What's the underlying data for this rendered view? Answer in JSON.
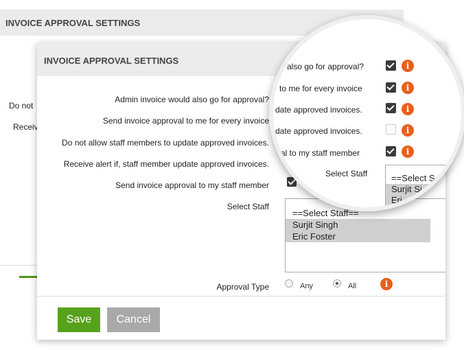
{
  "background": {
    "title": "INVOICE APPROVAL SETTINGS",
    "labels": [
      "Do not",
      "Receiv"
    ]
  },
  "dialog": {
    "title": "INVOICE APPROVAL SETTINGS",
    "rows": [
      {
        "label": "Admin invoice would also go for approval?",
        "checked": true
      },
      {
        "label": "Send invoice approval to me for every invoice",
        "checked": true
      },
      {
        "label": "Do not allow staff members to update approved invoices.",
        "checked": true
      },
      {
        "label": "Receive alert if, staff member update approved invoices.",
        "checked": false
      },
      {
        "label": "Send invoice approval to my staff member",
        "checked": true
      }
    ],
    "select_staff_label": "Select Staff",
    "staff_options": [
      {
        "label": "==Select Staff==",
        "selected": false
      },
      {
        "label": "Surjit Singh",
        "selected": true
      },
      {
        "label": "Eric Foster",
        "selected": true
      }
    ],
    "approval_type_label": "Approval Type",
    "approval_options": [
      {
        "label": "Any",
        "selected": false
      },
      {
        "label": "All",
        "selected": true
      }
    ],
    "info_glyph": "i",
    "save_label": "Save",
    "cancel_label": "Cancel"
  },
  "magnifier": {
    "rows": [
      {
        "label": "also go for approval?",
        "checked": true
      },
      {
        "label": "to me for every invoice",
        "checked": true
      },
      {
        "label": "date approved invoices.",
        "checked": true
      },
      {
        "label": "date approved invoices.",
        "checked": false
      },
      {
        "label": "val to my staff member",
        "checked": true
      }
    ],
    "select_staff_label": "Select Staff",
    "staff_options": [
      {
        "label": "==Select S",
        "selected": false
      },
      {
        "label": "Surjit Si",
        "selected": true
      },
      {
        "label": "Eri",
        "selected": true
      }
    ]
  },
  "colors": {
    "accent_info": "#e8601c",
    "save_button": "#57a21c",
    "cancel_button": "#a9a9a9",
    "header_bg": "#ececec"
  }
}
